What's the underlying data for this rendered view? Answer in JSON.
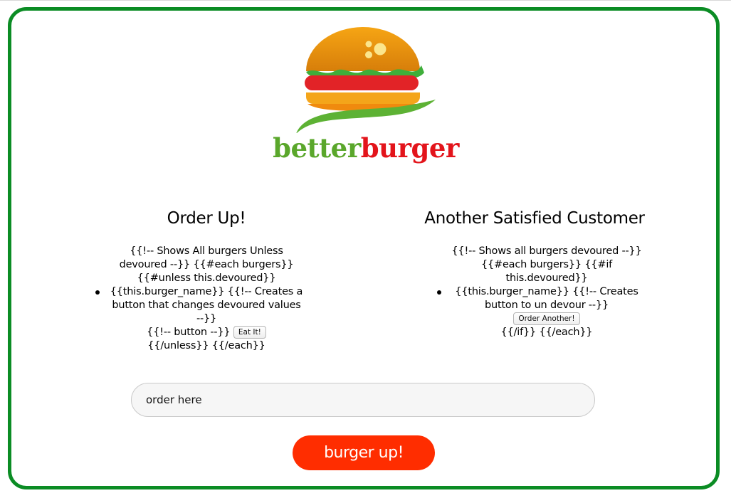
{
  "brand": {
    "part1": "better",
    "part2": "burger",
    "part1_color": "#5aa72b",
    "part2_color": "#e3141b"
  },
  "left_column": {
    "heading": "Order Up!",
    "pre_lines": [
      "{{!-- Shows All burgers Unless",
      "devoured --}} {{#each burgers}}",
      "{{#unless this.devoured}}"
    ],
    "item_lines": [
      "{{this.burger_name}} {{!-- Creates a",
      "button that changes devoured values",
      "--}}"
    ],
    "button_comment": "{{!-- button --}}",
    "button_label": "Eat It!",
    "post_line": "{{/unless}} {{/each}}"
  },
  "right_column": {
    "heading": "Another Satisfied Customer",
    "pre_lines": [
      "{{!-- Shows all burgers devoured --}}",
      "{{#each burgers}} {{#if this.devoured}}"
    ],
    "item_lines": [
      "{{this.burger_name}} {{!-- Creates",
      "button to un devour --}}"
    ],
    "button_label": "Order Another!",
    "post_line": "{{/if}} {{/each}}"
  },
  "form": {
    "input_placeholder": "order here",
    "submit_label": "burger up!"
  },
  "colors": {
    "frame_border": "#0b8c24",
    "submit_bg": "#ff2d00"
  }
}
